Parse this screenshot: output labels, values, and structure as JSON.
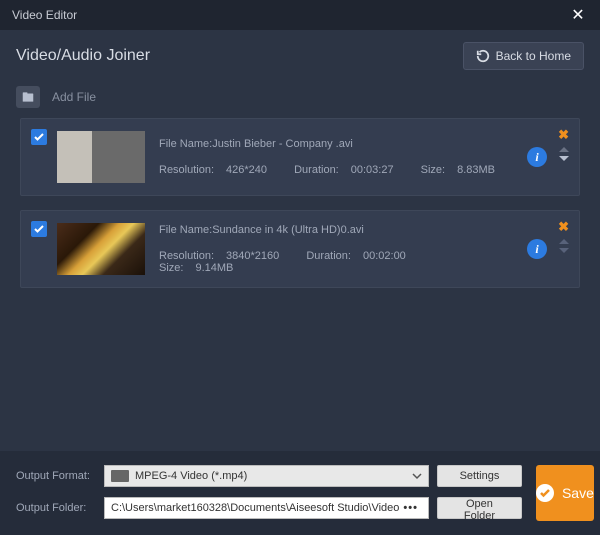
{
  "titlebar": {
    "title": "Video Editor"
  },
  "header": {
    "title": "Video/Audio Joiner",
    "back_label": "Back to Home"
  },
  "toolbar": {
    "add_file_label": "Add File"
  },
  "files": [
    {
      "filename_label": "File Name:",
      "filename": "Justin Bieber - Company .avi",
      "resolution_label": "Resolution:",
      "resolution": "426*240",
      "duration_label": "Duration:",
      "duration": "00:03:27",
      "size_label": "Size:",
      "size": "8.83MB",
      "checked": true
    },
    {
      "filename_label": "File Name:",
      "filename": "Sundance in 4k (Ultra HD)0.avi",
      "resolution_label": "Resolution:",
      "resolution": "3840*2160",
      "duration_label": "Duration:",
      "duration": "00:02:00",
      "size_label": "Size:",
      "size": "9.14MB",
      "checked": true
    }
  ],
  "footer": {
    "format_label": "Output Format:",
    "format_value": "MPEG-4 Video (*.mp4)",
    "settings_label": "Settings",
    "folder_label": "Output Folder:",
    "folder_value": "C:\\Users\\market160328\\Documents\\Aiseesoft Studio\\Video",
    "open_folder_label": "Open Folder",
    "save_label": "Save"
  }
}
